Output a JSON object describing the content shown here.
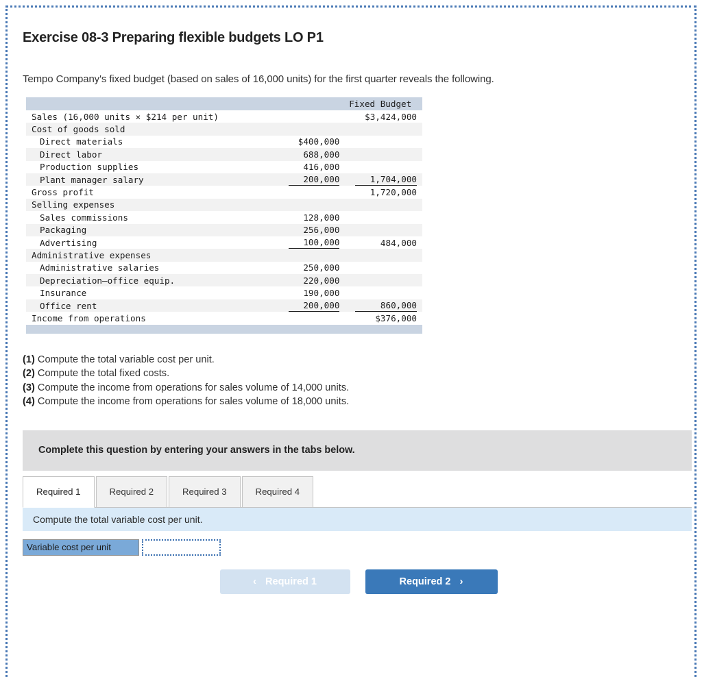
{
  "header": {
    "exercise_title": "Exercise 08-3 Preparing flexible budgets LO P1",
    "intro": "Tempo Company's fixed budget (based on sales of 16,000 units) for the first quarter reveals the following."
  },
  "budget_table": {
    "column_header": "Fixed Budget",
    "rows": [
      {
        "label": "Sales (16,000 units × $214 per unit)",
        "indent": 0,
        "col1": "",
        "col2": "$3,424,000",
        "shade": false,
        "rule1": "none",
        "rule2": "none"
      },
      {
        "label": "Cost of goods sold",
        "indent": 0,
        "col1": "",
        "col2": "",
        "shade": true,
        "rule1": "none",
        "rule2": "none"
      },
      {
        "label": "Direct materials",
        "indent": 1,
        "col1": "$400,000",
        "col2": "",
        "shade": false,
        "rule1": "none",
        "rule2": "none"
      },
      {
        "label": "Direct labor",
        "indent": 1,
        "col1": "688,000",
        "col2": "",
        "shade": true,
        "rule1": "none",
        "rule2": "none"
      },
      {
        "label": "Production supplies",
        "indent": 1,
        "col1": "416,000",
        "col2": "",
        "shade": false,
        "rule1": "none",
        "rule2": "none"
      },
      {
        "label": "Plant manager salary",
        "indent": 1,
        "col1": "200,000",
        "col2": "1,704,000",
        "shade": true,
        "rule1": "single",
        "rule2": "single"
      },
      {
        "label": "Gross profit",
        "indent": 0,
        "col1": "",
        "col2": "1,720,000",
        "shade": false,
        "rule1": "none",
        "rule2": "none"
      },
      {
        "label": "Selling expenses",
        "indent": 0,
        "col1": "",
        "col2": "",
        "shade": true,
        "rule1": "none",
        "rule2": "none"
      },
      {
        "label": "Sales commissions",
        "indent": 1,
        "col1": "128,000",
        "col2": "",
        "shade": false,
        "rule1": "none",
        "rule2": "none"
      },
      {
        "label": "Packaging",
        "indent": 1,
        "col1": "256,000",
        "col2": "",
        "shade": true,
        "rule1": "none",
        "rule2": "none"
      },
      {
        "label": "Advertising",
        "indent": 1,
        "col1": "100,000",
        "col2": "484,000",
        "shade": false,
        "rule1": "single",
        "rule2": "none"
      },
      {
        "label": "Administrative expenses",
        "indent": 0,
        "col1": "",
        "col2": "",
        "shade": true,
        "rule1": "none",
        "rule2": "none"
      },
      {
        "label": "Administrative salaries",
        "indent": 1,
        "col1": "250,000",
        "col2": "",
        "shade": false,
        "rule1": "none",
        "rule2": "none"
      },
      {
        "label": "Depreciation—office equip.",
        "indent": 1,
        "col1": "220,000",
        "col2": "",
        "shade": true,
        "rule1": "none",
        "rule2": "none"
      },
      {
        "label": "Insurance",
        "indent": 1,
        "col1": "190,000",
        "col2": "",
        "shade": false,
        "rule1": "none",
        "rule2": "none"
      },
      {
        "label": "Office rent",
        "indent": 1,
        "col1": "200,000",
        "col2": "860,000",
        "shade": true,
        "rule1": "single",
        "rule2": "single"
      },
      {
        "label": "Income from operations",
        "indent": 0,
        "col1": "",
        "col2": "376,000",
        "col2_symbol": "$",
        "shade": false,
        "rule1": "none",
        "rule2": "double"
      }
    ]
  },
  "requirements": [
    {
      "num": "(1)",
      "text": " Compute the total variable cost per unit."
    },
    {
      "num": "(2)",
      "text": " Compute the total fixed costs."
    },
    {
      "num": "(3)",
      "text": " Compute the income from operations for sales volume of 14,000 units."
    },
    {
      "num": "(4)",
      "text": " Compute the income from operations for sales volume of 18,000 units."
    }
  ],
  "instructions": {
    "gray_band": "Complete this question by entering your answers in the tabs below."
  },
  "tabs": [
    {
      "label": "Required 1",
      "active": true
    },
    {
      "label": "Required 2",
      "active": false
    },
    {
      "label": "Required 3",
      "active": false
    },
    {
      "label": "Required 4",
      "active": false
    }
  ],
  "panel": {
    "prompt": "Compute the total variable cost per unit.",
    "answer_label": "Variable cost per unit",
    "answer_value": "",
    "answer_placeholder": ""
  },
  "navigation": {
    "prev_label": "Required 1",
    "next_label": "Required 2",
    "prev_chevron": "‹",
    "next_chevron": "›"
  },
  "colors": {
    "accent_blue": "#3a79b9",
    "prev_button": "#d3e2f1",
    "table_header": "#c9d4e2",
    "strip_blue": "#d9eaf8",
    "gray_band": "#dededf",
    "answer_label": "#7aa9d8",
    "frame_dotted": "#4a79b5"
  }
}
